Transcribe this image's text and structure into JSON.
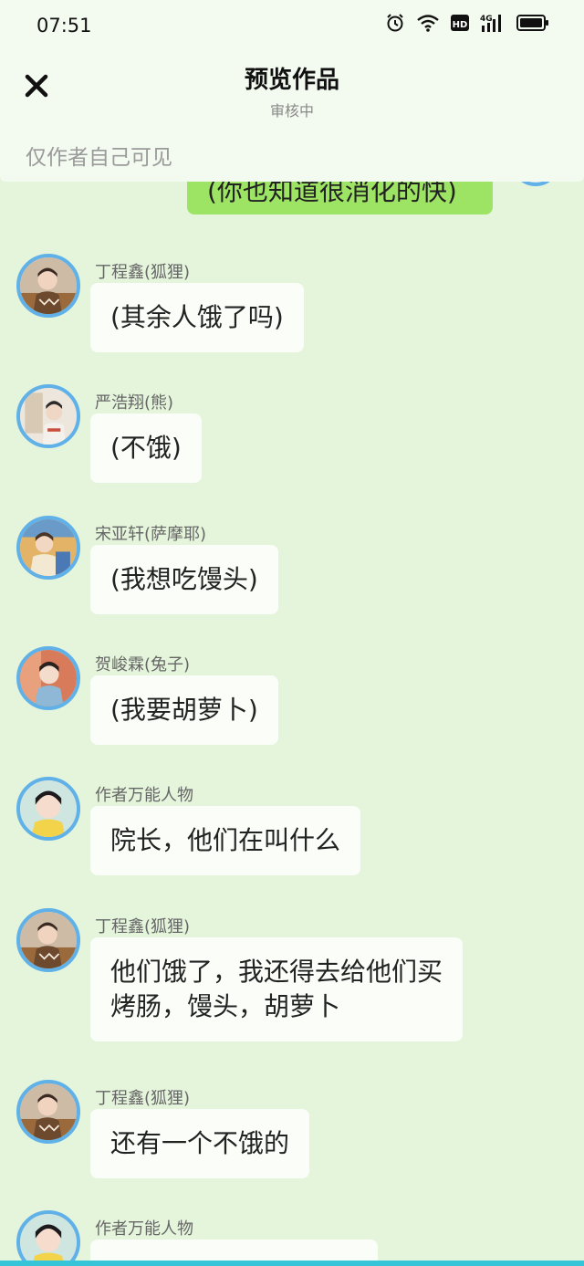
{
  "status_bar": {
    "time": "07:51",
    "icons": [
      "alarm-icon",
      "wifi-icon",
      "hd-icon",
      "signal-4g-icon",
      "battery-icon"
    ]
  },
  "header": {
    "title": "预览作品",
    "subtitle": "审核中",
    "visibility_note": "仅作者自己可见"
  },
  "self_message": {
    "text": "(你也知道很消化的快)"
  },
  "messages": [
    {
      "sender": "丁程鑫(狐狸)",
      "text": "(其余人饿了吗)"
    },
    {
      "sender": "严浩翔(熊)",
      "text": "(不饿)"
    },
    {
      "sender": "宋亚轩(萨摩耶)",
      "text": "(我想吃馒头)"
    },
    {
      "sender": "贺峻霖(兔子)",
      "text": "(我要胡萝卜)"
    },
    {
      "sender": "作者万能人物",
      "text": "院长，他们在叫什么"
    },
    {
      "sender": "丁程鑫(狐狸)",
      "text": "他们饿了，我还得去给他们买\n烤肠，馒头，胡萝卜"
    },
    {
      "sender": "丁程鑫(狐狸)",
      "text": "还有一个不饿的"
    },
    {
      "sender": "作者万能人物",
      "text": ""
    }
  ],
  "colors": {
    "background": "#e5f5dc",
    "self_bubble": "#9de465",
    "other_bubble": "#fafdf8",
    "avatar_ring": "#5fb1e8",
    "header_bg": "#f3faef"
  }
}
